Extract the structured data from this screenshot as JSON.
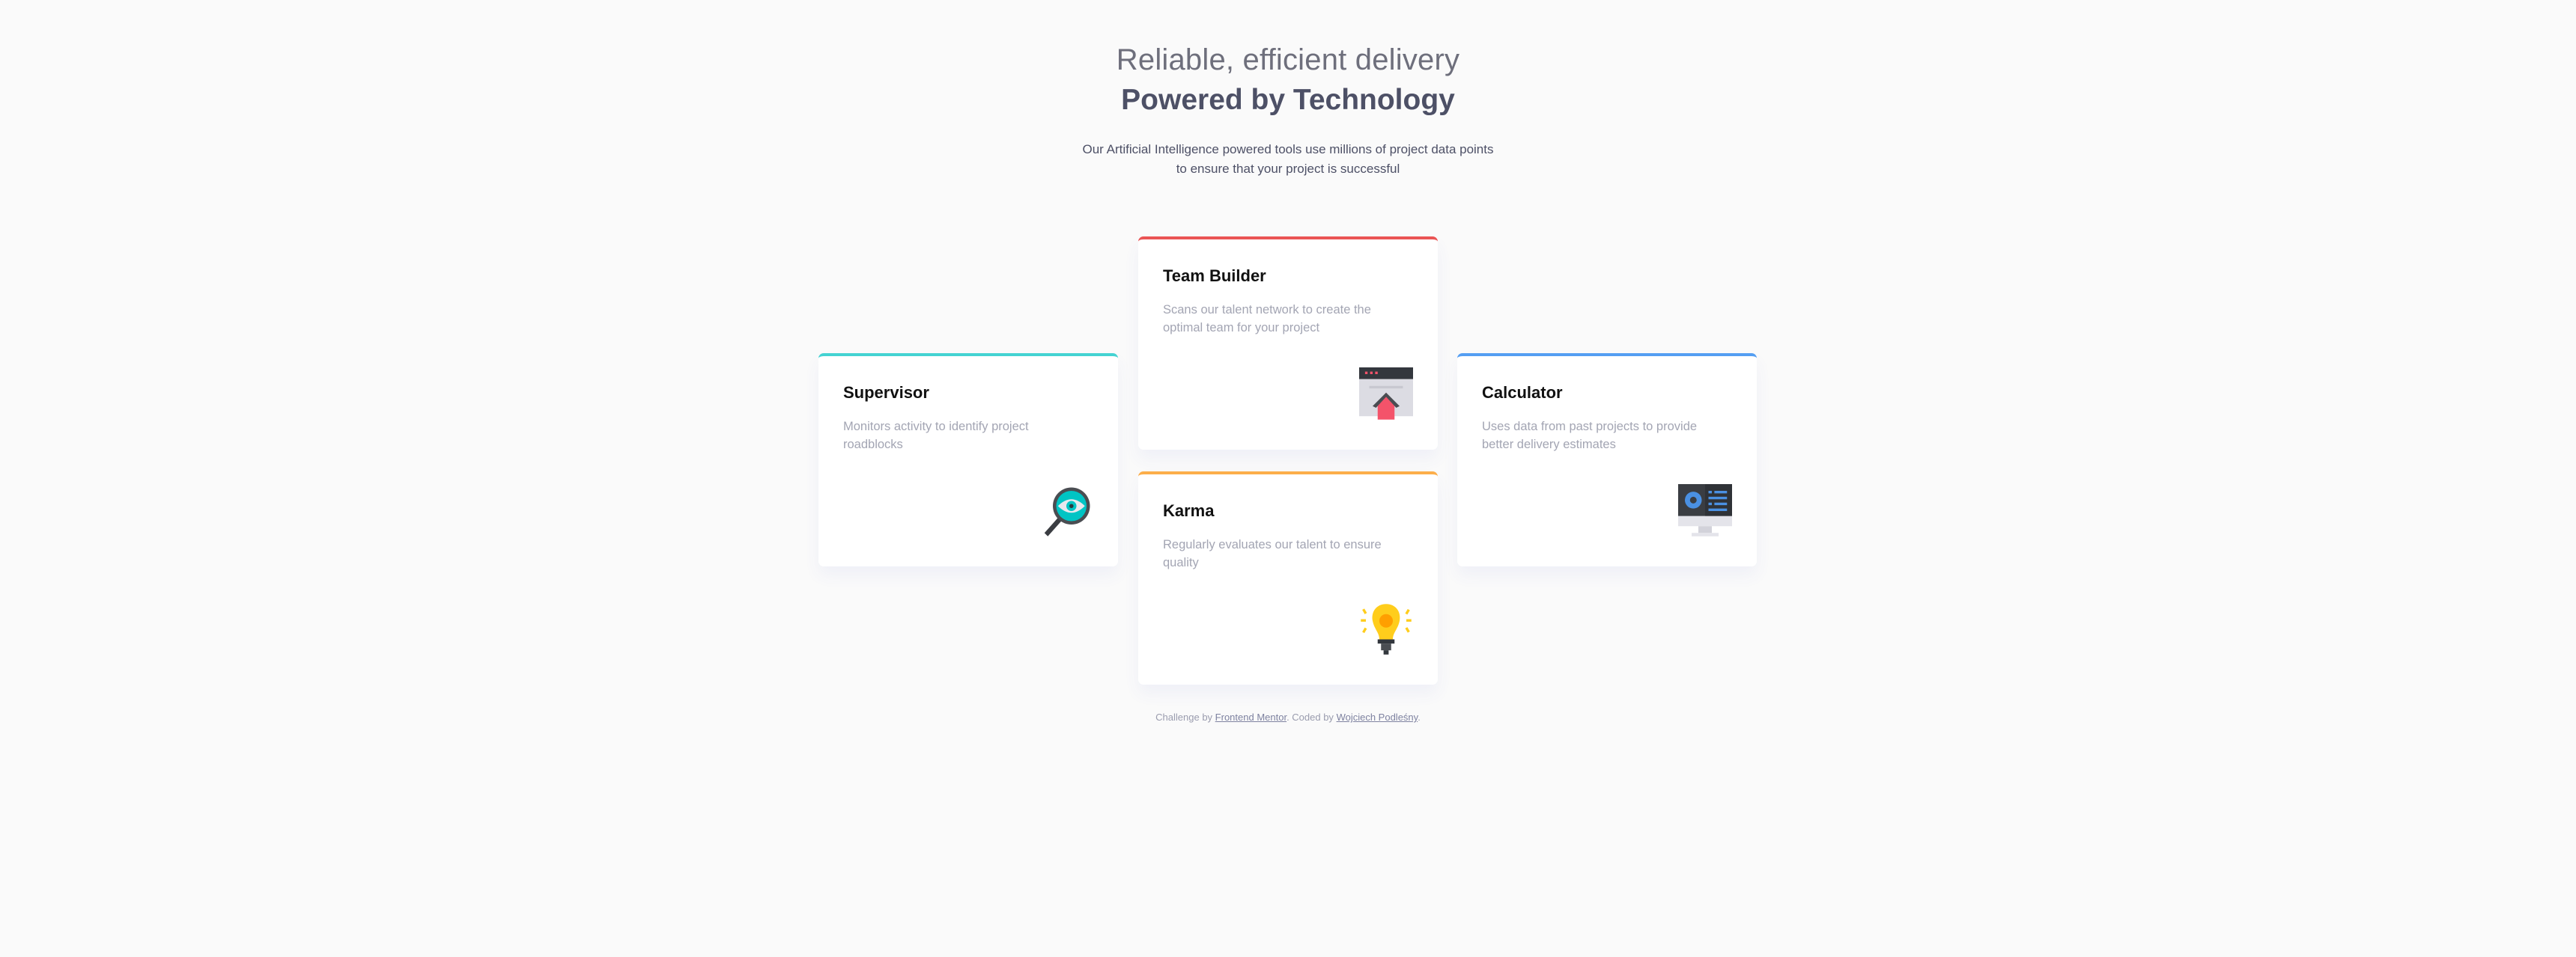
{
  "header": {
    "subtitle": "Reliable, efficient delivery",
    "title": "Powered by Technology",
    "intro": "Our Artificial Intelligence powered tools use millions of project data points to ensure that your project is successful"
  },
  "cards": [
    {
      "title": "Supervisor",
      "description": "Monitors activity to identify project roadblocks",
      "icon": "magnifier-eye-icon",
      "accent": "#44d3d2"
    },
    {
      "title": "Team Builder",
      "description": "Scans our talent network to create the optimal team for your project",
      "icon": "browser-house-icon",
      "accent": "#ea5454"
    },
    {
      "title": "Karma",
      "description": "Regularly evaluates our talent to ensure quality",
      "icon": "lightbulb-icon",
      "accent": "#fcae4a"
    },
    {
      "title": "Calculator",
      "description": "Uses data from past projects to provide better delivery estimates",
      "icon": "monitor-chart-icon",
      "accent": "#549ef2"
    }
  ],
  "footer": {
    "prefix": "Challenge by ",
    "link1": "Frontend Mentor",
    "middle": ". Coded by ",
    "link2": "Wojciech Podleśny",
    "suffix": "."
  }
}
